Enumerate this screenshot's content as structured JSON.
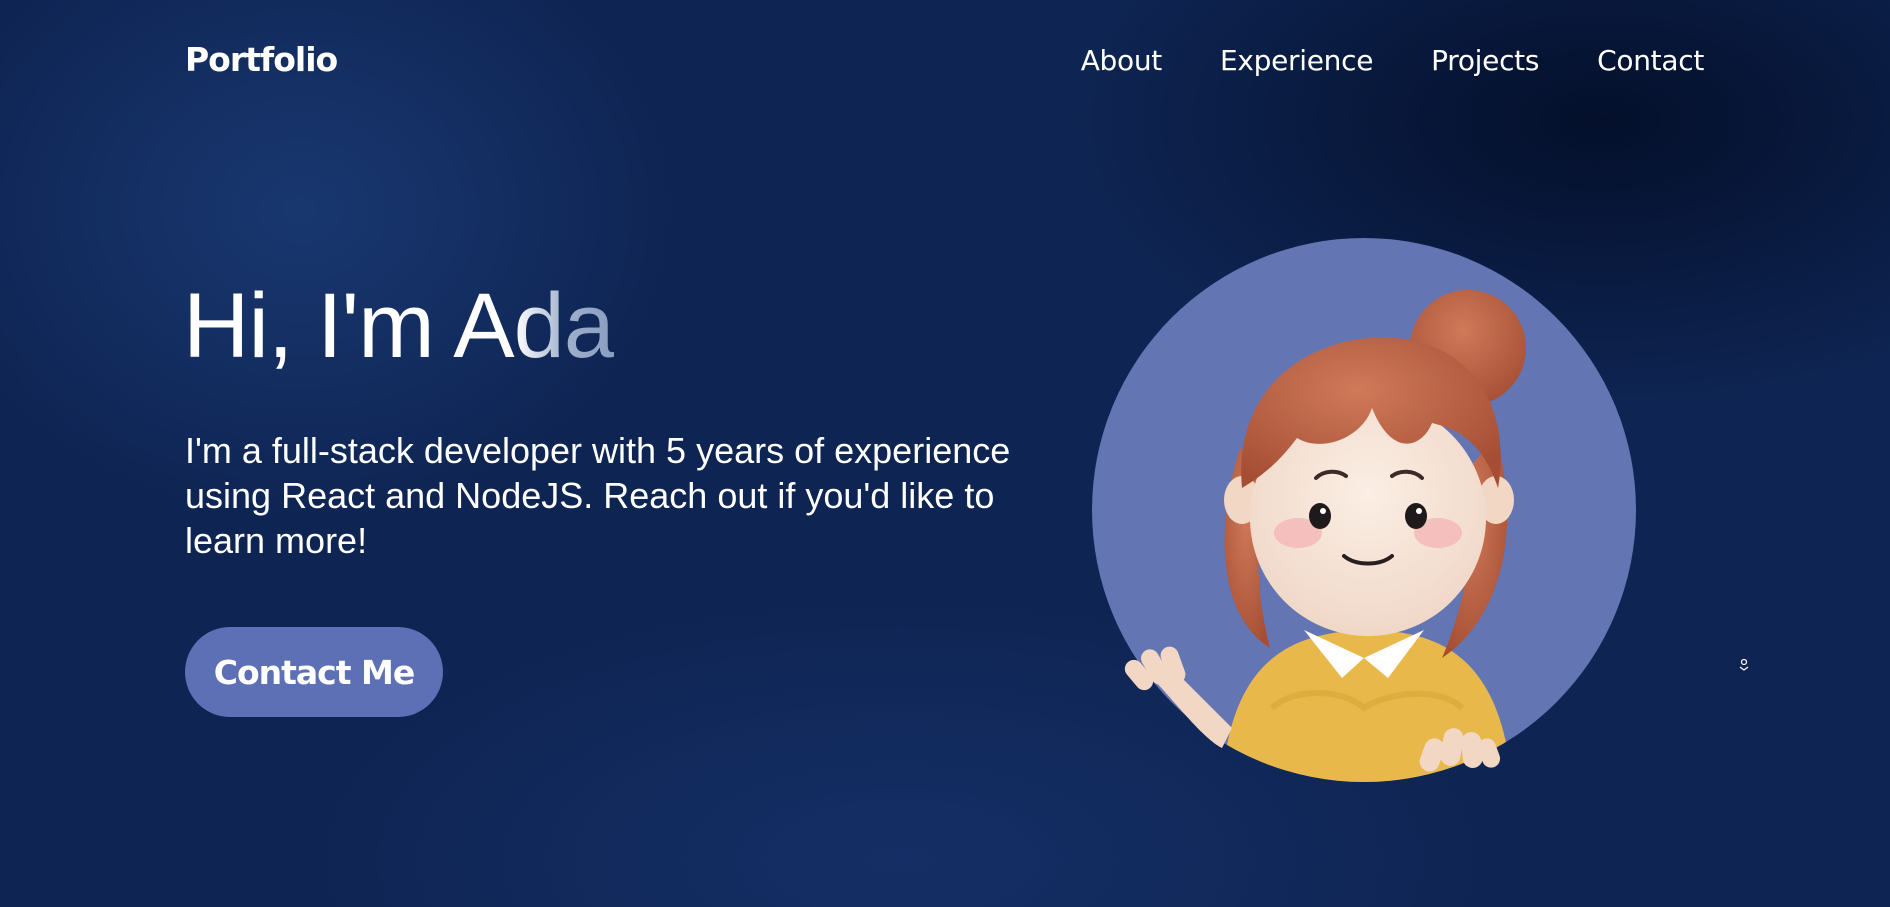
{
  "header": {
    "brand": "Portfolio",
    "nav": [
      {
        "label": "About"
      },
      {
        "label": "Experience"
      },
      {
        "label": "Projects"
      },
      {
        "label": "Contact"
      }
    ]
  },
  "hero": {
    "greeting_prefix": "Hi, I'm ",
    "name": "Ada",
    "description": "I'm a full-stack developer with 5 years of experience using React and NodeJS. Reach out if you'd like to learn more!",
    "cta_label": "Contact Me"
  },
  "avatar": {
    "icon": "avatar-illustration"
  },
  "colors": {
    "background": "#0e2452",
    "accent": "#5d70b6",
    "avatar_circle": "#6475b4",
    "text": "#ffffff"
  }
}
